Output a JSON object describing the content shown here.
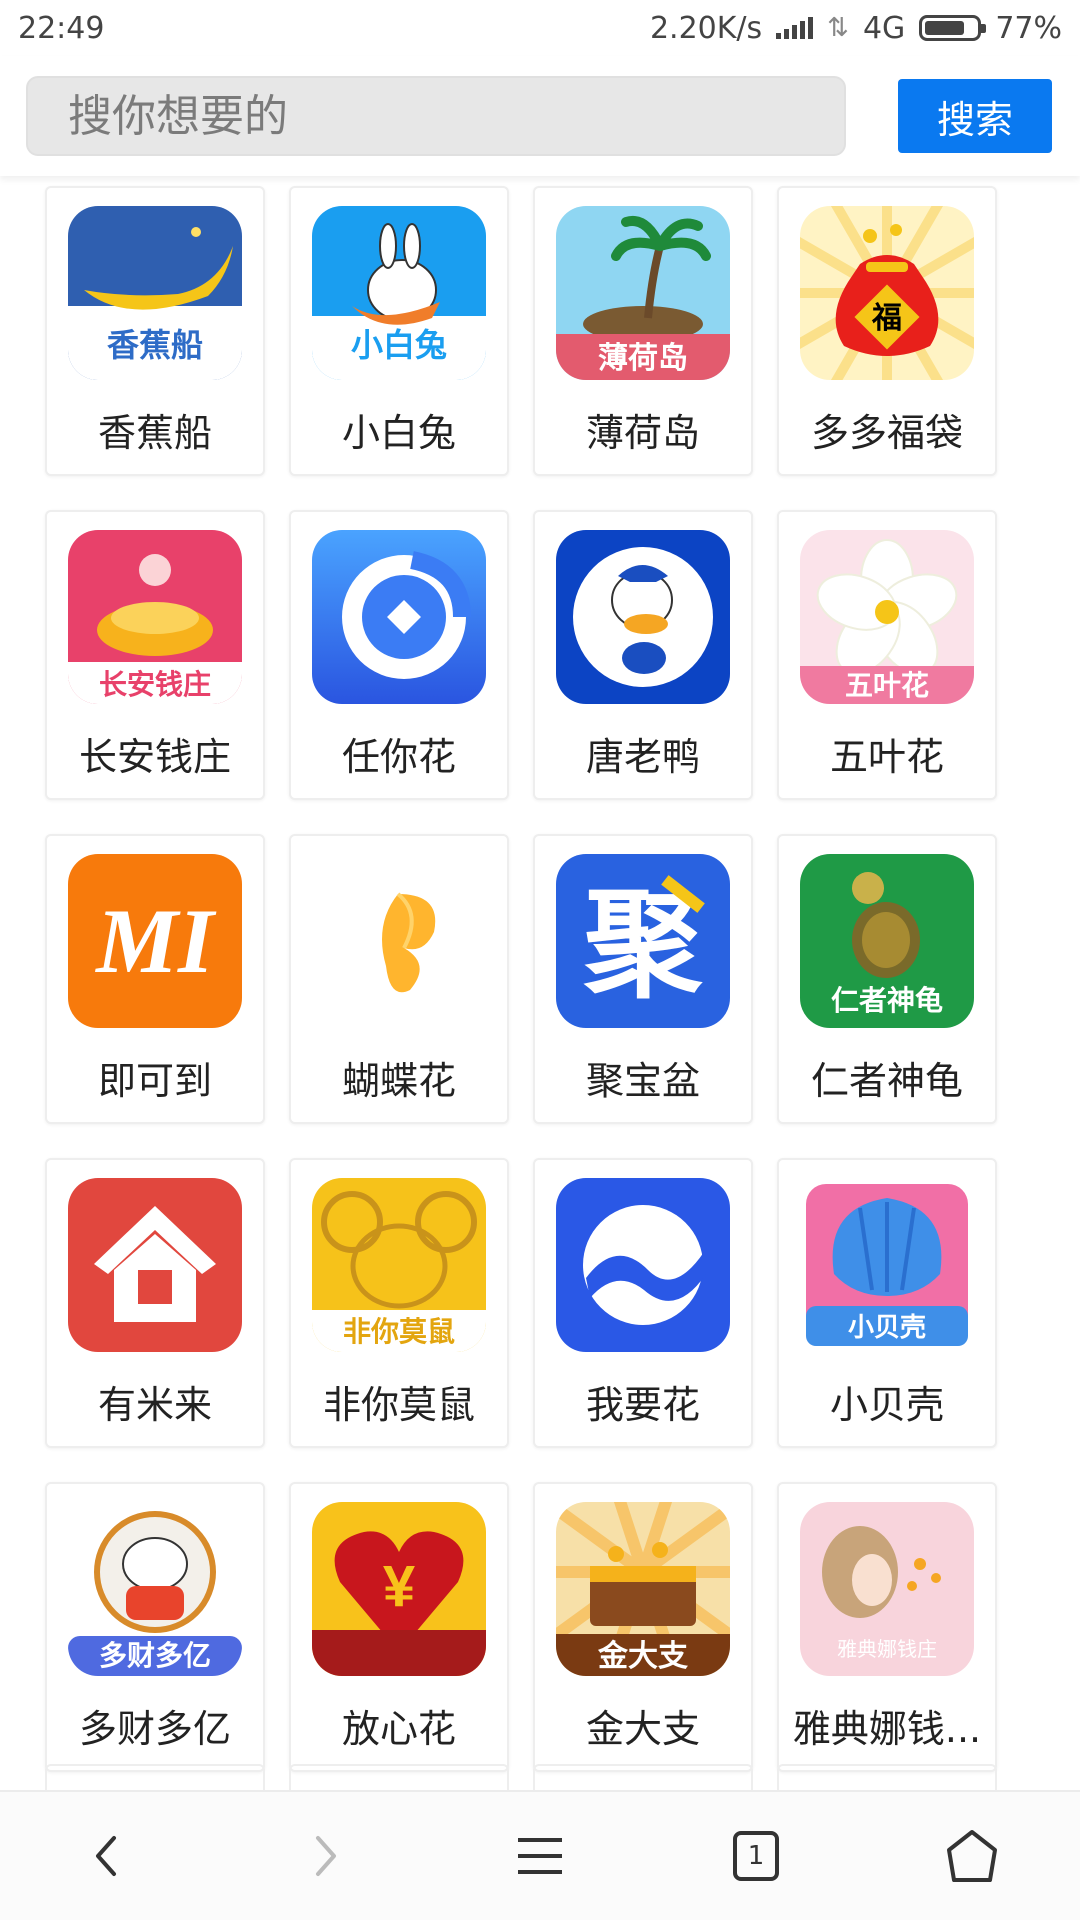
{
  "status": {
    "time": "22:49",
    "speed": "2.20K/s",
    "network": "4G",
    "battery": "77%",
    "battery_level": 0.77
  },
  "search": {
    "placeholder": "搜你想要的",
    "button_label": "搜索"
  },
  "apps": [
    {
      "label": "香蕉船",
      "icon": "banana-boat-icon",
      "badge": "香蕉船"
    },
    {
      "label": "小白兔",
      "icon": "white-rabbit-icon",
      "badge": "小白兔"
    },
    {
      "label": "薄荷岛",
      "icon": "mint-island-icon",
      "badge": "薄荷岛"
    },
    {
      "label": "多多福袋",
      "icon": "lucky-bag-icon",
      "badge": "福"
    },
    {
      "label": "长安钱庄",
      "icon": "changan-bank-icon",
      "badge": "长安钱庄"
    },
    {
      "label": "任你花",
      "icon": "renni-coin-icon",
      "badge": ""
    },
    {
      "label": "唐老鸭",
      "icon": "donald-duck-icon",
      "badge": ""
    },
    {
      "label": "五叶花",
      "icon": "five-leaf-flower-icon",
      "badge": "五叶花"
    },
    {
      "label": "即可到",
      "icon": "jikedao-icon",
      "badge": "MI"
    },
    {
      "label": "蝴蝶花",
      "icon": "butterfly-flower-icon",
      "badge": ""
    },
    {
      "label": "聚宝盆",
      "icon": "jubaopen-icon",
      "badge": "聚"
    },
    {
      "label": "仁者神龟",
      "icon": "turtle-icon",
      "badge": "仁者神龟"
    },
    {
      "label": "有米来",
      "icon": "house-icon",
      "badge": ""
    },
    {
      "label": "非你莫鼠",
      "icon": "mouse-icon",
      "badge": "非你莫鼠"
    },
    {
      "label": "我要花",
      "icon": "wave-circle-icon",
      "badge": ""
    },
    {
      "label": "小贝壳",
      "icon": "shell-icon",
      "badge": "小贝壳"
    },
    {
      "label": "多财多亿",
      "icon": "lucky-cat-icon",
      "badge": "多财多亿"
    },
    {
      "label": "放心花",
      "icon": "heart-yuan-icon",
      "badge": "¥"
    },
    {
      "label": "金大支",
      "icon": "treasure-chest-icon",
      "badge": "金大支"
    },
    {
      "label": "雅典娜钱...",
      "icon": "athena-icon",
      "badge": "雅典娜钱庄"
    }
  ],
  "nav": {
    "tab_count": "1"
  }
}
